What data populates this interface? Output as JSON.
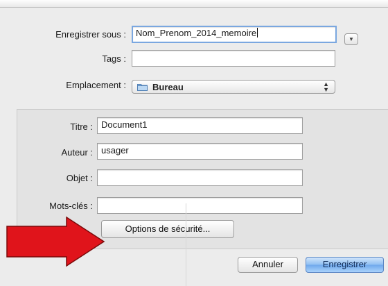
{
  "save_as": {
    "label": "Enregistrer sous :",
    "value": "Nom_Prenom_2014_memoire"
  },
  "tags": {
    "label": "Tags :",
    "value": ""
  },
  "location": {
    "label": "Emplacement :",
    "value": "Bureau",
    "icon": "folder-icon"
  },
  "metadata": {
    "title": {
      "label": "Titre :",
      "value": "Document1"
    },
    "author": {
      "label": "Auteur :",
      "value": "usager"
    },
    "subject": {
      "label": "Objet :",
      "value": ""
    },
    "keywords": {
      "label": "Mots-clés :",
      "value": ""
    },
    "security_button": "Options de sécurité..."
  },
  "buttons": {
    "cancel": "Annuler",
    "save": "Enregistrer"
  },
  "colors": {
    "arrow": "#e0141b",
    "primary_button": "#6fa8ec",
    "focus_ring": "#7aa7e0"
  }
}
